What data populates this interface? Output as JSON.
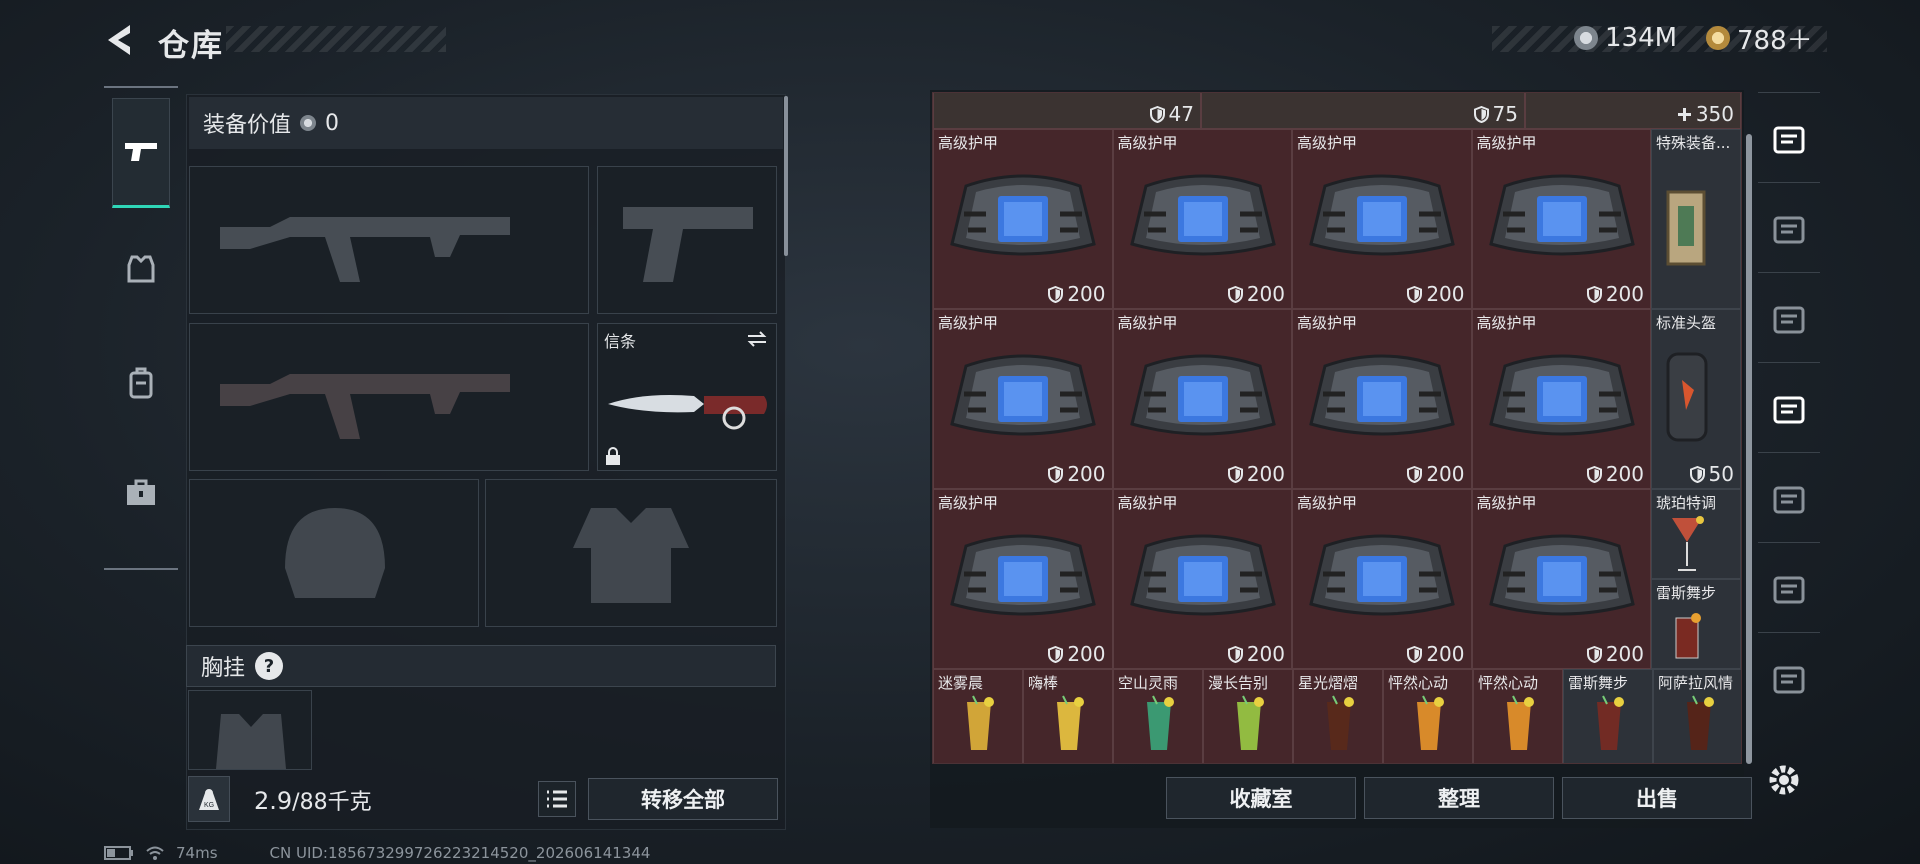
{
  "header": {
    "title": "仓库",
    "currency": [
      {
        "icon": "silver-coin-icon",
        "value": "134M"
      },
      {
        "icon": "gold-coin-icon",
        "value": "788＋"
      }
    ]
  },
  "left_tabs": [
    {
      "icon": "pistol-icon",
      "active": true
    },
    {
      "icon": "armor-icon",
      "active": false
    },
    {
      "icon": "backpack-icon",
      "active": false
    },
    {
      "icon": "toolbox-icon",
      "active": false
    }
  ],
  "loadout": {
    "equip_value_label": "装备价值",
    "equip_value": "0",
    "melee_label": "信条",
    "vest_label": "胸挂",
    "help": "?"
  },
  "footer_left": {
    "weight_current": "2.9",
    "weight_total": "/88千克",
    "transfer_all": "转移全部"
  },
  "status": {
    "ping": "74ms",
    "uid": "CN UID:185673299726223214520_202606141344"
  },
  "storage": {
    "top_row": [
      {
        "value": "47"
      },
      {
        "value": "75"
      },
      {
        "value": "350"
      }
    ],
    "armor_name": "高级护甲",
    "armor_value": "200",
    "side_items": [
      {
        "name": "特殊装备...",
        "icon": "document-case-icon"
      },
      {
        "name": "标准头盔",
        "value": "50",
        "icon": "helmet-icon"
      },
      {
        "name": "琥珀特调",
        "icon": "cocktail-icon"
      },
      {
        "name": "雷斯舞步",
        "icon": "cocktail-icon"
      }
    ],
    "bottom_row": [
      "迷雾晨",
      "嗨棒",
      "空山灵雨",
      "漫长告别",
      "星光熠熠",
      "怦然心动",
      "怦然心动",
      "雷斯舞步",
      "阿萨拉风情"
    ],
    "buttons": [
      "收藏室",
      "整理",
      "出售"
    ]
  },
  "right_tabs": [
    {
      "icon": "safe-icon"
    },
    {
      "icon": "armor-iv-icon"
    },
    {
      "icon": "gti-case-icon"
    },
    {
      "icon": "weapon-iv-plus-icon"
    },
    {
      "icon": "rifle-iv-icon"
    },
    {
      "icon": "gti-weapon-icon"
    },
    {
      "icon": "weapon-v-icon"
    },
    {
      "icon": "gear-icon"
    }
  ],
  "colors": {
    "accent": "#2fd6b7",
    "armor_cell": "#45262a"
  }
}
